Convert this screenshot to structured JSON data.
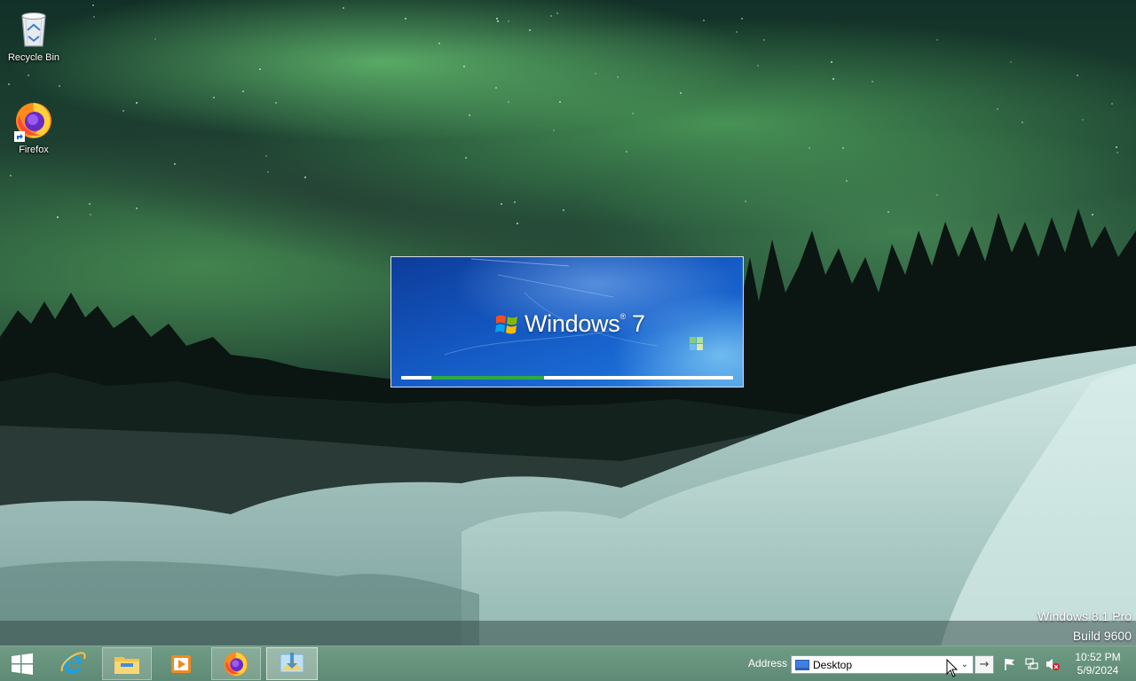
{
  "desktop": {
    "icons": [
      {
        "label": "Recycle Bin",
        "icon": "recycle-bin-icon"
      },
      {
        "label": "Firefox",
        "icon": "firefox-icon"
      }
    ],
    "watermark": {
      "line1": "Windows 8.1 Pro",
      "line2": "Build 9600"
    }
  },
  "splash": {
    "brand": "Windows",
    "version": "7",
    "progress": {
      "start": 0.09,
      "end": 0.43
    }
  },
  "taskbar": {
    "apps": [
      {
        "name": "Start",
        "icon": "windows-start-icon",
        "state": "idle"
      },
      {
        "name": "Internet Explorer",
        "icon": "internet-explorer-icon",
        "state": "idle"
      },
      {
        "name": "File Explorer",
        "icon": "file-explorer-icon",
        "state": "running"
      },
      {
        "name": "Media Player",
        "icon": "media-player-icon",
        "state": "idle"
      },
      {
        "name": "Firefox",
        "icon": "firefox-icon",
        "state": "running"
      },
      {
        "name": "Windows 7 setup",
        "icon": "windows7-setup-icon",
        "state": "active"
      }
    ],
    "address": {
      "label": "Address",
      "value": "Desktop"
    },
    "tray": {
      "icons": [
        "action-center-flag-icon",
        "network-icon",
        "volume-muted-icon"
      ]
    },
    "clock": {
      "time": "10:52 PM",
      "date": "5/9/2024"
    }
  },
  "colors": {
    "taskbar": "#6f9b85",
    "progress": "#2ea944",
    "splash_blue": "#1458c2"
  }
}
